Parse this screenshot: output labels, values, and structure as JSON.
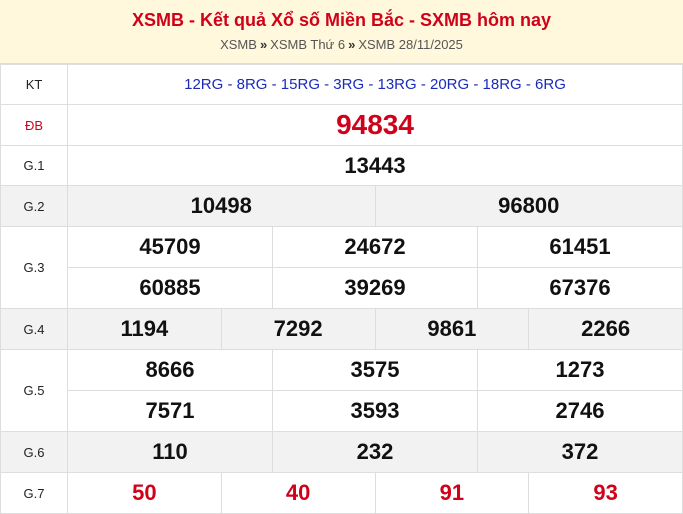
{
  "header": {
    "title": "XSMB - Kết quả Xổ số Miền Bắc - SXMB hôm nay",
    "breadcrumb": [
      "XSMB",
      "XSMB Thứ 6",
      "XSMB 28/11/2025"
    ],
    "separator": "»"
  },
  "results": {
    "kt": {
      "label": "KT",
      "value": "12RG - 8RG - 15RG - 3RG - 13RG - 20RG - 18RG - 6RG"
    },
    "db": {
      "label": "ĐB",
      "value": "94834"
    },
    "g1": {
      "label": "G.1",
      "values": [
        "13443"
      ]
    },
    "g2": {
      "label": "G.2",
      "values": [
        "10498",
        "96800"
      ]
    },
    "g3": {
      "label": "G.3",
      "values": [
        "45709",
        "24672",
        "61451",
        "60885",
        "39269",
        "67376"
      ]
    },
    "g4": {
      "label": "G.4",
      "values": [
        "1194",
        "7292",
        "9861",
        "2266"
      ]
    },
    "g5": {
      "label": "G.5",
      "values": [
        "8666",
        "3575",
        "1273",
        "7571",
        "3593",
        "2746"
      ]
    },
    "g6": {
      "label": "G.6",
      "values": [
        "110",
        "232",
        "372"
      ]
    },
    "g7": {
      "label": "G.7",
      "values": [
        "50",
        "40",
        "91",
        "93"
      ]
    }
  }
}
